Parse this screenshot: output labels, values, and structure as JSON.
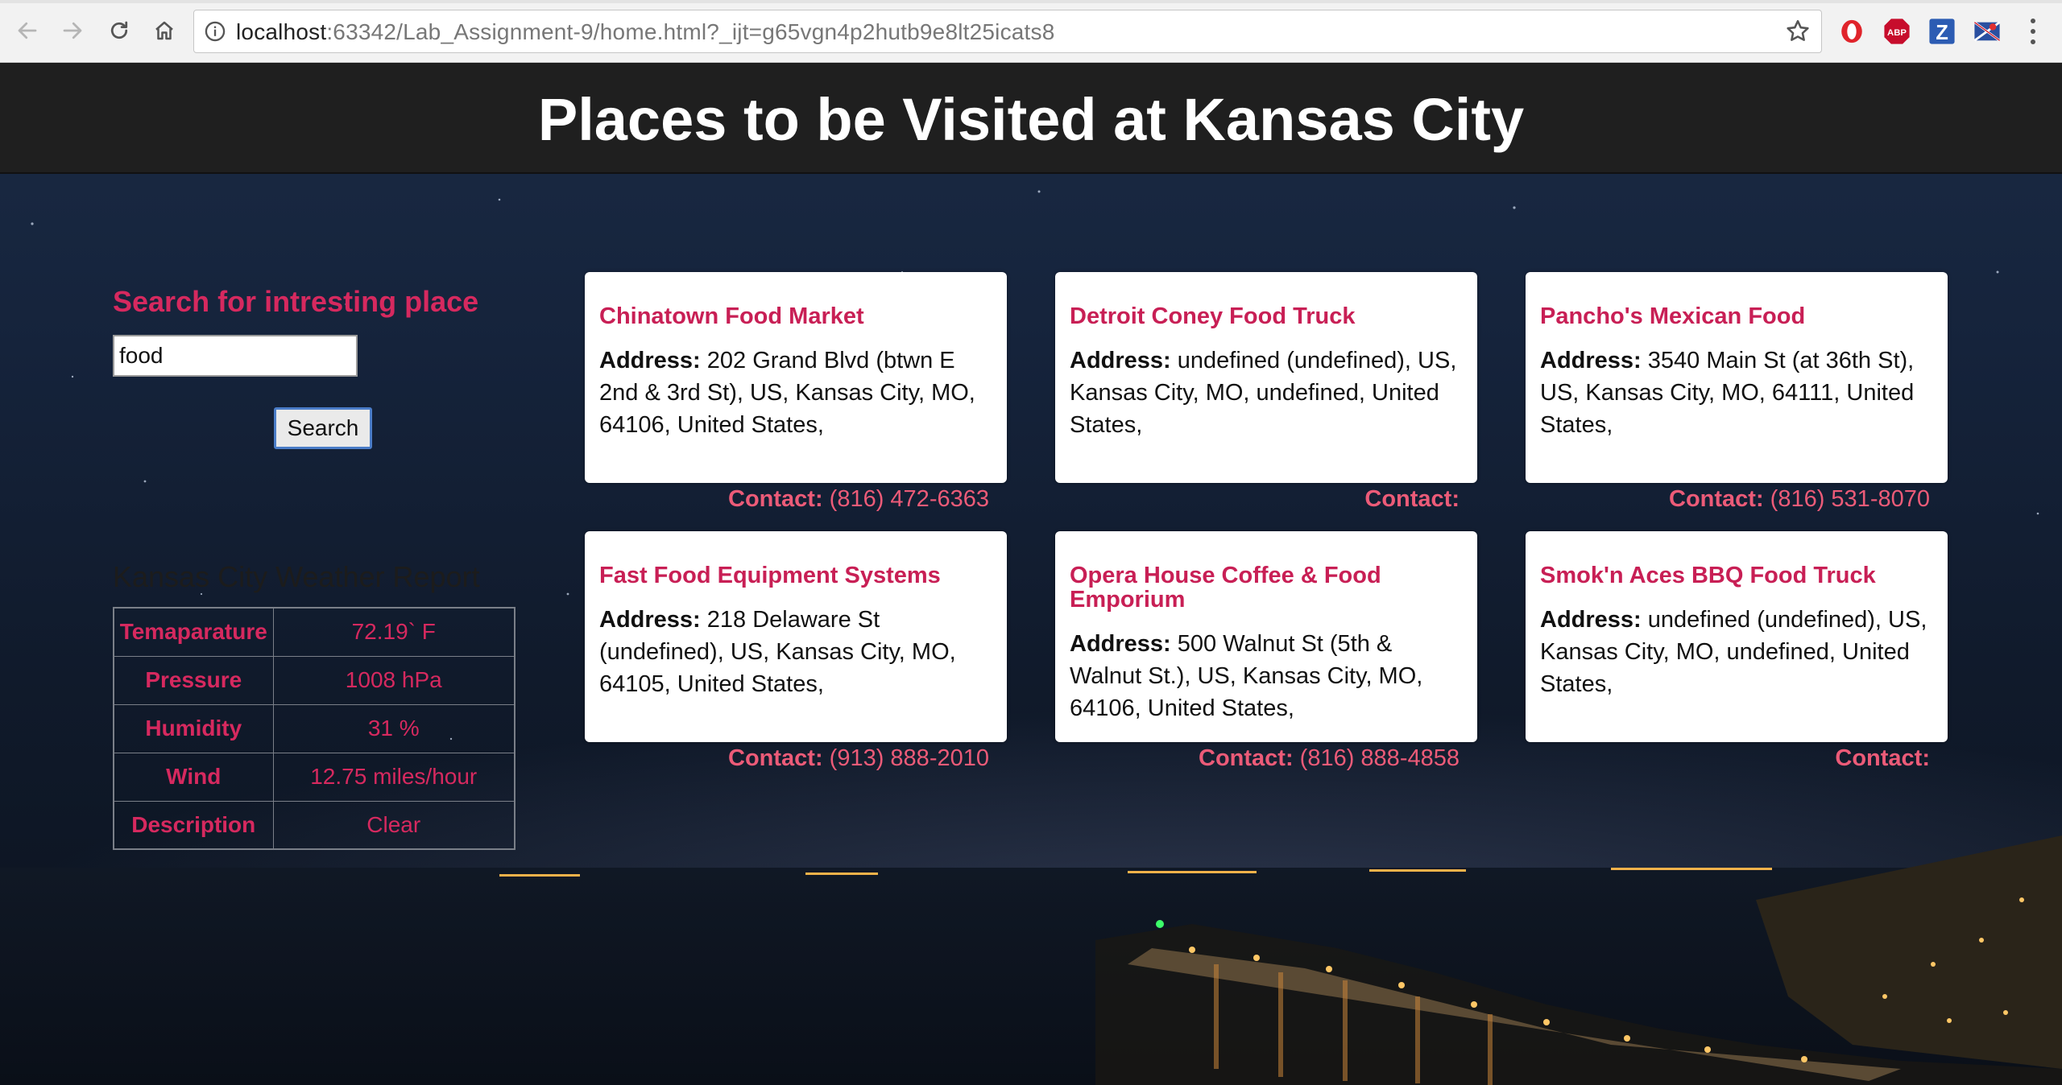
{
  "browser": {
    "url_host": "localhost",
    "url_rest": ":63342/Lab_Assignment-9/home.html?_ijt=g65vgn4p2hutb9e8lt25icats8",
    "nav_icons": [
      "back-icon",
      "forward-icon",
      "reload-icon",
      "home-icon"
    ],
    "extensions": [
      {
        "name": "opera-extension-icon",
        "label": "",
        "color": "#e0242b"
      },
      {
        "name": "adblock-plus-icon",
        "label": "ABP",
        "color": "#c70d2c"
      },
      {
        "name": "zotero-icon",
        "label": "Z",
        "color": "#2c5cb3"
      },
      {
        "name": "flag-extension-icon",
        "label": "",
        "color": "#2a4fa0"
      }
    ]
  },
  "header": {
    "title": "Places to be Visited at Kansas City"
  },
  "search": {
    "title": "Search for intresting place",
    "value": "food",
    "button_label": "Search"
  },
  "weather": {
    "title": "Kansas City Weather Report",
    "rows": [
      {
        "label": "Temaparature",
        "value": "72.19` F"
      },
      {
        "label": "Pressure",
        "value": "1008 hPa"
      },
      {
        "label": "Humidity",
        "value": "31 %"
      },
      {
        "label": "Wind",
        "value": "12.75 miles/hour"
      },
      {
        "label": "Description",
        "value": "Clear"
      }
    ]
  },
  "places": [
    {
      "name": "Chinatown Food Market",
      "address_label": "Address:",
      "address": "202 Grand Blvd (btwn E 2nd & 3rd St), US, Kansas City, MO, 64106, United States,",
      "contact_label": "Contact:",
      "contact": "(816) 472-6363"
    },
    {
      "name": "Detroit Coney Food Truck",
      "address_label": "Address:",
      "address": "undefined (undefined), US, Kansas City, MO, undefined, United States,",
      "contact_label": "Contact:",
      "contact": ""
    },
    {
      "name": "Pancho's Mexican Food",
      "address_label": "Address:",
      "address": "3540 Main St (at 36th St), US, Kansas City, MO, 64111, United States,",
      "contact_label": "Contact:",
      "contact": "(816) 531-8070"
    },
    {
      "name": "Fast Food Equipment Systems",
      "address_label": "Address:",
      "address": "218 Delaware St (undefined), US, Kansas City, MO, 64105, United States,",
      "contact_label": "Contact:",
      "contact": "(913) 888-2010"
    },
    {
      "name": "Opera House Coffee & Food Emporium",
      "address_label": "Address:",
      "address": "500 Walnut St (5th & Walnut St.), US, Kansas City, MO, 64106, United States,",
      "contact_label": "Contact:",
      "contact": "(816) 888-4858"
    },
    {
      "name": "Smok'n Aces BBQ Food Truck",
      "address_label": "Address:",
      "address": "undefined (undefined), US, Kansas City, MO, undefined, United States,",
      "contact_label": "Contact:",
      "contact": ""
    }
  ],
  "colors": {
    "accent": "#d6295f",
    "contact": "#ec5b78",
    "header_bg": "#1f1f1f"
  }
}
